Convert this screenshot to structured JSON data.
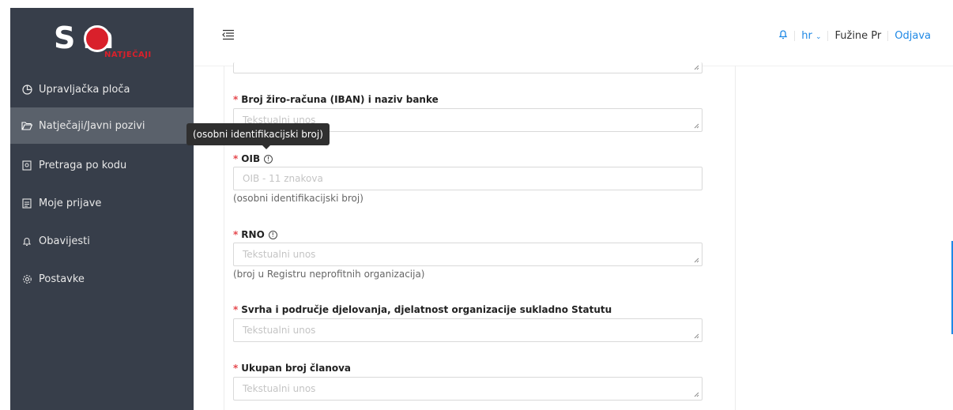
{
  "logo": {
    "text": "S m",
    "subtitle": "NATJEČAJI"
  },
  "sidebar": {
    "items": [
      {
        "label": "Upravljačka ploča",
        "icon": "pie-chart-icon"
      },
      {
        "label": "Natječaji/Javni pozivi",
        "icon": "folder-open-icon",
        "active": true
      },
      {
        "label": "Pretraga po kodu",
        "icon": "file-search-icon"
      },
      {
        "label": "Moje prijave",
        "icon": "file-text-icon"
      },
      {
        "label": "Obavijesti",
        "icon": "bell-icon"
      },
      {
        "label": "Postavke",
        "icon": "gear-icon"
      }
    ]
  },
  "tooltip": {
    "text": "(osobni identifikacijski broj)"
  },
  "topbar": {
    "language": "hr",
    "user": "Fužine Pr",
    "logout": "Odjava"
  },
  "form": {
    "iban": {
      "label": "Broj žiro-računa (IBAN) i naziv banke",
      "placeholder": "Tekstualni unos"
    },
    "oib": {
      "label": "OIB",
      "placeholder": "OIB - 11 znakova",
      "hint": "(osobni identifikacijski broj)"
    },
    "rno": {
      "label": "RNO",
      "placeholder": "Tekstualni unos",
      "hint": "(broj u Registru neprofitnih organizacija)"
    },
    "svrha": {
      "label": "Svrha i područje djelovanja, djelatnost organizacije sukladno Statutu",
      "placeholder": "Tekstualni unos"
    },
    "clanovi": {
      "label": "Ukupan broj članova",
      "placeholder": "Tekstualni unos"
    }
  },
  "colors": {
    "sidebar": "#373e4a",
    "active": "#5a616b",
    "accent": "#1e88e5",
    "brand": "#d9202b",
    "required": "#e5484d"
  }
}
